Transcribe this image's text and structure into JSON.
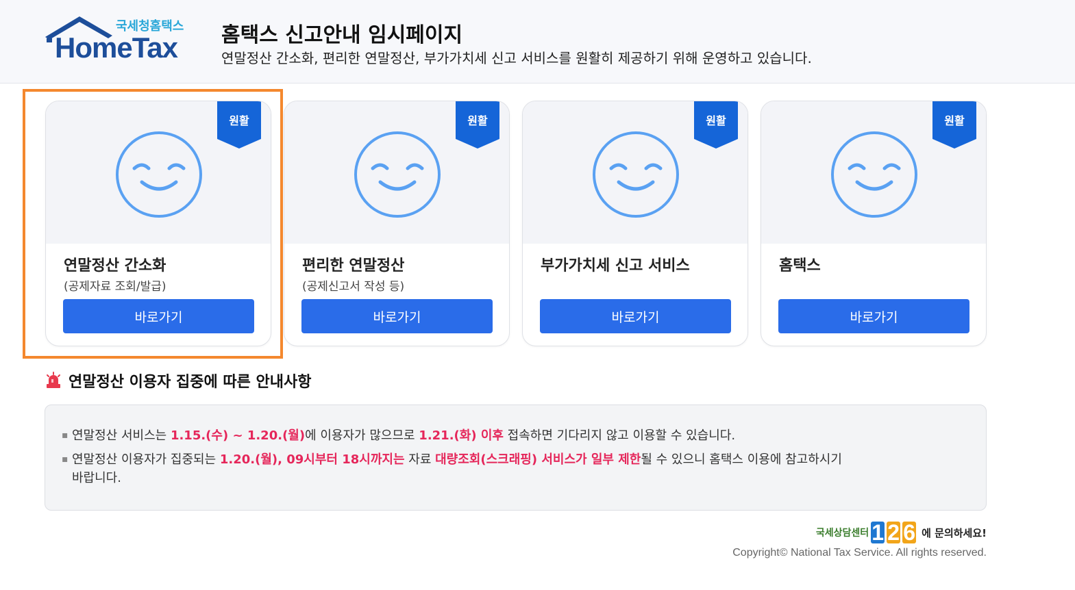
{
  "header": {
    "logo_small": "국세청홈택스",
    "logo_big": "HomeTax",
    "title": "홈택스 신고안내 임시페이지",
    "description": "연말정산 간소화, 편리한 연말정산, 부가가치세 신고 서비스를 원활히 제공하기 위해 운영하고 있습니다."
  },
  "cards": [
    {
      "badge": "원활",
      "title": "연말정산 간소화",
      "subtitle": "(공제자료 조회/발급)",
      "button": "바로가기"
    },
    {
      "badge": "원활",
      "title": "편리한 연말정산",
      "subtitle": "(공제신고서 작성 등)",
      "button": "바로가기"
    },
    {
      "badge": "원활",
      "title": "부가가치세 신고 서비스",
      "subtitle": "",
      "button": "바로가기"
    },
    {
      "badge": "원활",
      "title": "홈택스",
      "subtitle": "",
      "button": "바로가기"
    }
  ],
  "notice": {
    "title": "연말정산 이용자 집중에 따른 안내사항",
    "line1": {
      "a": "연말정산 서비스는 ",
      "b": "1.15.(수) ~ 1.20.(월)",
      "c": "에 이용자가 많으므로 ",
      "d": "1.21.(화) 이후",
      "e": " 접속하면 기다리지 않고 이용할 수 있습니다."
    },
    "line2": {
      "a": "연말정산 이용자가 집중되는 ",
      "b": "1.20.(월), 09시부터 18시까지는",
      "c": " 자료 ",
      "d": "대량조회(스크래핑) 서비스가 일부 제한",
      "e": "될 수 있으니 홈택스 이용에 참고하시기",
      "f": "바랍니다."
    }
  },
  "footer": {
    "help_prefix": "국세상담센터",
    "help_digits": [
      "1",
      "2",
      "6"
    ],
    "help_suffix": "에 문의하세요!",
    "copyright": "Copyright© National Tax Service. All rights reserved."
  },
  "colors": {
    "accent": "#2a6ce9",
    "ribbon": "#1565d8",
    "smiley": "#5aa1f2",
    "highlight_text": "#e5265a",
    "selection_outline": "#f4882e"
  },
  "icons": {
    "card": "smiley-icon",
    "badge": "ribbon-badge-icon",
    "notice": "siren-icon"
  }
}
